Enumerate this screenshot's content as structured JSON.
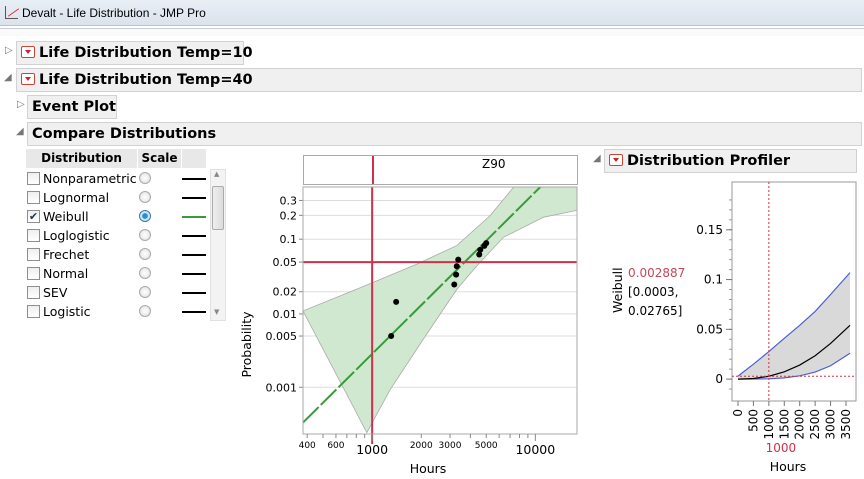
{
  "window": {
    "title": "Devalt - Life Distribution - JMP Pro"
  },
  "outline": {
    "temp10": "Life Distribution Temp=10",
    "temp40": "Life Distribution Temp=40",
    "event_plot": "Event Plot",
    "compare": "Compare Distributions",
    "profiler": "Distribution Profiler"
  },
  "table": {
    "headers": [
      "Distribution",
      "Scale",
      ""
    ],
    "rows": [
      {
        "label": "Nonparametric",
        "checked": false,
        "scale": false,
        "line_color": "#000000"
      },
      {
        "label": "Lognormal",
        "checked": false,
        "scale": false,
        "line_color": "#000000"
      },
      {
        "label": "Weibull",
        "checked": true,
        "scale": true,
        "line_color": "#3a9a3a"
      },
      {
        "label": "Loglogistic",
        "checked": false,
        "scale": false,
        "line_color": "#000000"
      },
      {
        "label": "Frechet",
        "checked": false,
        "scale": false,
        "line_color": "#000000"
      },
      {
        "label": "Normal",
        "checked": false,
        "scale": false,
        "line_color": "#000000"
      },
      {
        "label": "SEV",
        "checked": false,
        "scale": false,
        "line_color": "#000000"
      },
      {
        "label": "Logistic",
        "checked": false,
        "scale": false,
        "line_color": "#000000"
      }
    ]
  },
  "chart_data": [
    {
      "type": "scatter",
      "scale": "weibull probability vs log hours",
      "top_label": "Z90",
      "xlabel": "Hours",
      "ylabel": "Probability",
      "xlim": [
        377,
        18000
      ],
      "ylim": [
        0.00023,
        0.42
      ],
      "x_ticks_small": [
        "400",
        "600",
        "2000",
        "3000",
        "5000"
      ],
      "x_ticks_small_values": [
        400,
        600,
        2000,
        3000,
        5000
      ],
      "x_ticks_big": [
        "1000",
        "10000"
      ],
      "x_ticks_big_values": [
        1000,
        10000
      ],
      "y_ticks": [
        "0.3",
        "0.2",
        "0.1",
        "0.05",
        "0.02",
        "0.01",
        "0.005",
        "0.001"
      ],
      "y_tick_values": [
        0.3,
        0.2,
        0.1,
        0.05,
        0.02,
        0.01,
        0.005,
        0.001
      ],
      "points": [
        [
          1308,
          0.005
        ],
        [
          1403,
          0.0146
        ],
        [
          3185,
          0.025
        ],
        [
          3270,
          0.034
        ],
        [
          3300,
          0.044
        ],
        [
          3370,
          0.054
        ],
        [
          4530,
          0.063
        ],
        [
          4600,
          0.073
        ],
        [
          4870,
          0.082
        ],
        [
          5000,
          0.089
        ]
      ],
      "fit_line": [
        [
          377,
          0.00033
        ],
        [
          10730,
          0.42
        ]
      ],
      "band_upper": [
        [
          377,
          0.011
        ],
        [
          806,
          0.0217
        ],
        [
          1880,
          0.047
        ],
        [
          3310,
          0.083
        ],
        [
          5300,
          0.2
        ],
        [
          7370,
          0.42
        ],
        [
          18000,
          0.42
        ]
      ],
      "band_lower": [
        [
          18000,
          0.23
        ],
        [
          11240,
          0.19
        ],
        [
          6380,
          0.106
        ],
        [
          4390,
          0.0447
        ],
        [
          3310,
          0.0217
        ],
        [
          2065,
          0.00457
        ],
        [
          1290,
          0.00093
        ],
        [
          928,
          0.00024
        ]
      ],
      "reference_x": 1000,
      "reference_y": 0.05,
      "colors": {
        "fit": "#3a9a3a",
        "band": "#cfe8cf",
        "ref": "#d0304a"
      }
    },
    {
      "type": "line",
      "ylabel": "Weibull",
      "xlabel": "Hours",
      "current_value": "0.002887",
      "interval": "[0.0003,",
      "interval_end": "0.02765]",
      "current_x": "1000",
      "xlim": [
        -194,
        3824
      ],
      "ylim": [
        -0.022,
        0.198
      ],
      "x_ticks": [
        "0",
        "500",
        "1000",
        "1500",
        "2000",
        "2500",
        "3000",
        "3500"
      ],
      "x_tick_values": [
        0,
        500,
        1000,
        1500,
        2000,
        2500,
        3000,
        3500
      ],
      "y_ticks": [
        "0.15",
        "0.1",
        "0.05",
        "0"
      ],
      "y_tick_values": [
        0.15,
        0.1,
        0.05,
        0
      ],
      "t": [
        0,
        500,
        1000,
        1500,
        2000,
        2500,
        3000,
        3630
      ],
      "series": [
        {
          "values": [
            0,
            0.00059,
            0.002887,
            0.0073,
            0.0141,
            0.0235,
            0.0358,
            0.054
          ]
        },
        {
          "values": [
            0.003,
            0.015,
            0.02765,
            0.041,
            0.054,
            0.068,
            0.085,
            0.107
          ]
        },
        {
          "values": [
            0,
            3e-05,
            0.0003,
            0.0012,
            0.0033,
            0.0071,
            0.0134,
            0.026
          ]
        }
      ],
      "colors": {
        "median": "#000000",
        "bounds": "#4a5fd0",
        "band": "#d9d9d9",
        "ref": "#d0304a"
      }
    }
  ]
}
